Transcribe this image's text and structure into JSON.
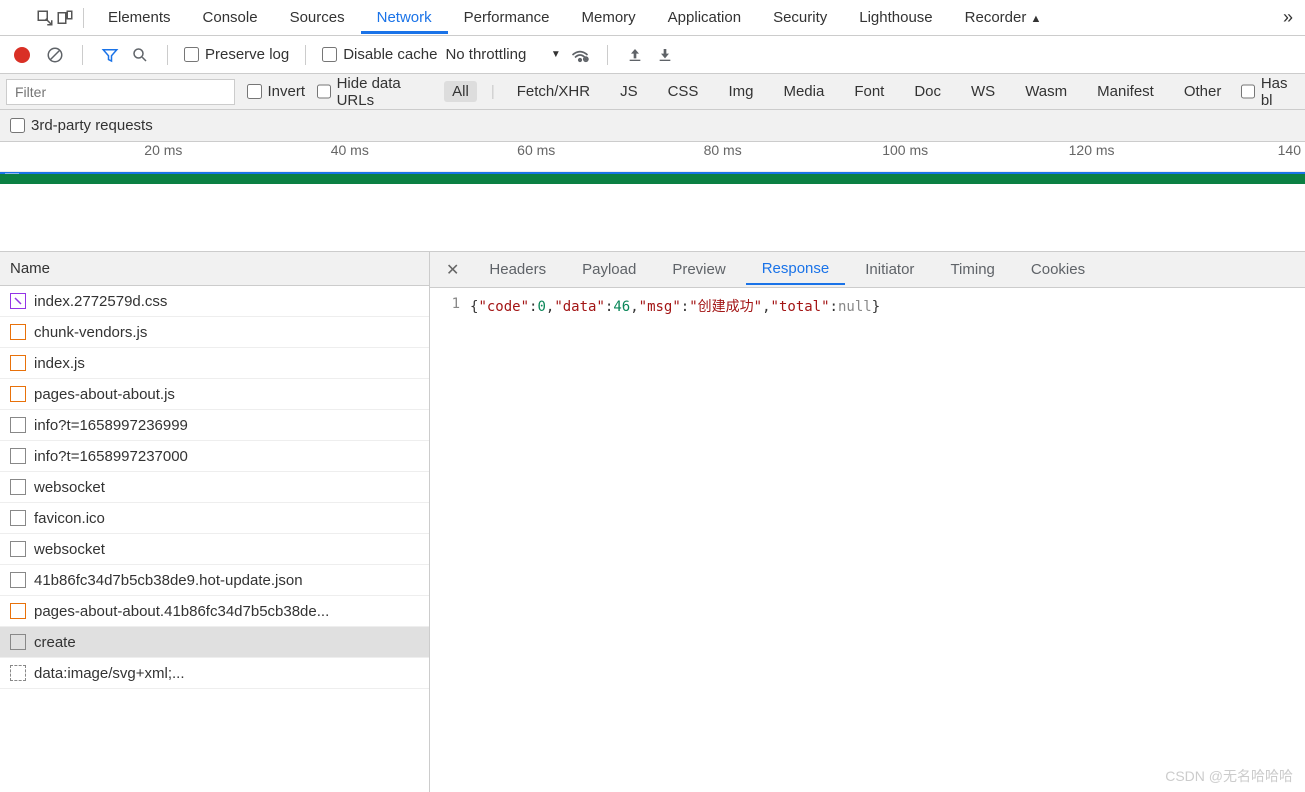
{
  "tabs": {
    "elements": "Elements",
    "console": "Console",
    "sources": "Sources",
    "network": "Network",
    "performance": "Performance",
    "memory": "Memory",
    "application": "Application",
    "security": "Security",
    "lighthouse": "Lighthouse",
    "recorder": "Recorder"
  },
  "toolbar": {
    "preserve_log": "Preserve log",
    "disable_cache": "Disable cache",
    "throttling": "No throttling"
  },
  "filter": {
    "placeholder": "Filter",
    "invert": "Invert",
    "hide_data_urls": "Hide data URLs",
    "types": {
      "all": "All",
      "fetch": "Fetch/XHR",
      "js": "JS",
      "css": "CSS",
      "img": "Img",
      "media": "Media",
      "font": "Font",
      "doc": "Doc",
      "ws": "WS",
      "wasm": "Wasm",
      "manifest": "Manifest",
      "other": "Other"
    },
    "has_bl": "Has bl",
    "third_party": "3rd-party requests"
  },
  "timeline": {
    "ticks": [
      "20 ms",
      "40 ms",
      "60 ms",
      "80 ms",
      "100 ms",
      "120 ms",
      "140"
    ]
  },
  "requests": {
    "header": "Name",
    "items": [
      {
        "icon": "css",
        "name": "index.2772579d.css"
      },
      {
        "icon": "js",
        "name": "chunk-vendors.js"
      },
      {
        "icon": "js",
        "name": "index.js"
      },
      {
        "icon": "js",
        "name": "pages-about-about.js"
      },
      {
        "icon": "xhr",
        "name": "info?t=1658997236999"
      },
      {
        "icon": "xhr",
        "name": "info?t=1658997237000"
      },
      {
        "icon": "xhr",
        "name": "websocket"
      },
      {
        "icon": "xhr",
        "name": "favicon.ico"
      },
      {
        "icon": "xhr",
        "name": "websocket"
      },
      {
        "icon": "xhr",
        "name": "41b86fc34d7b5cb38de9.hot-update.json"
      },
      {
        "icon": "js",
        "name": "pages-about-about.41b86fc34d7b5cb38de..."
      },
      {
        "icon": "xhr",
        "name": "create",
        "selected": true
      },
      {
        "icon": "other",
        "name": "data:image/svg+xml;..."
      }
    ]
  },
  "detail": {
    "tabs": {
      "headers": "Headers",
      "payload": "Payload",
      "preview": "Preview",
      "response": "Response",
      "initiator": "Initiator",
      "timing": "Timing",
      "cookies": "Cookies"
    },
    "line_no": "1",
    "response_json": {
      "code": 0,
      "data": 46,
      "msg": "创建成功",
      "total": null
    }
  },
  "watermark": "CSDN @无名哈哈哈"
}
